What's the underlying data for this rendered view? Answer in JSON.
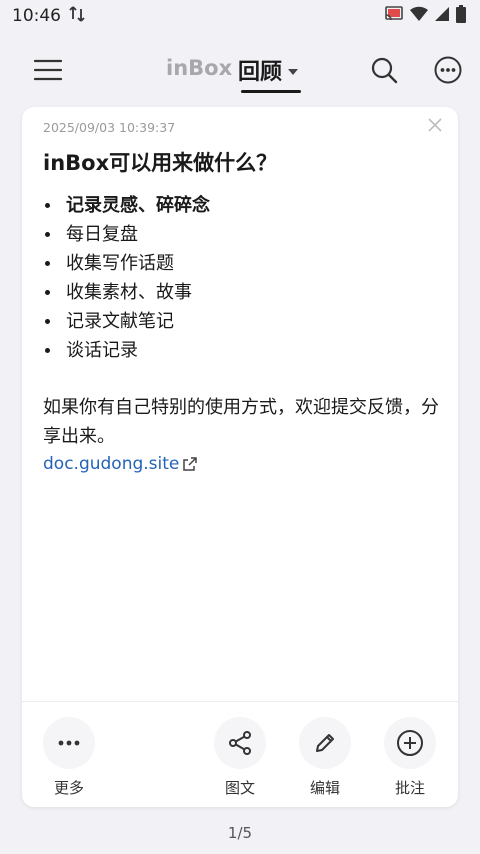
{
  "status_bar": {
    "time": "10:46"
  },
  "header": {
    "tab_inbox": "inBox",
    "tab_review": "回顾"
  },
  "card": {
    "timestamp": "2025/09/03 10:39:37",
    "title": "inBox可以用来做什么？",
    "items": [
      "记录灵感、碎碎念",
      "每日复盘",
      "收集写作话题",
      "收集素材、故事",
      "记录文献笔记",
      "谈话记录"
    ],
    "paragraph": "如果你有自己特别的使用方式，欢迎提交反馈，分享出来。",
    "link": "doc.gudong.site"
  },
  "actions": {
    "more": "更多",
    "share": "图文",
    "edit": "编辑",
    "annotate": "批注"
  },
  "pager": "1/5",
  "colors": {
    "background": "#f2f2f6",
    "link": "#2563b8",
    "inactive_tab": "#a8a8ac"
  }
}
